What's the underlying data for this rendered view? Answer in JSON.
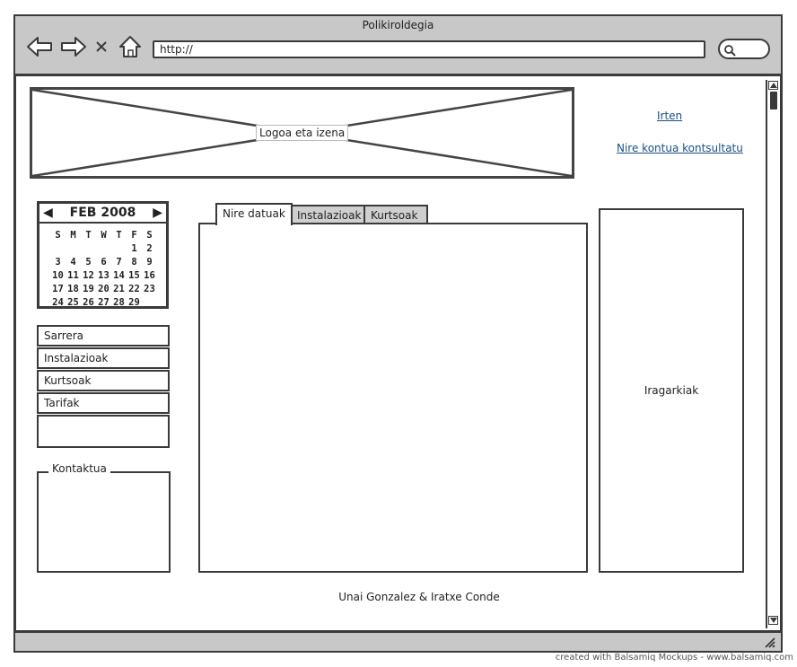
{
  "window": {
    "title": "Polikiroldegia"
  },
  "toolbar": {
    "url": "http://"
  },
  "header": {
    "logo_label": "Logoa eta izena",
    "links": {
      "logout": "Irten",
      "account": "Nire kontua kontsultatu"
    }
  },
  "calendar": {
    "month_label": "FEB 2008",
    "weekdays": [
      "S",
      "M",
      "T",
      "W",
      "T",
      "F",
      "S"
    ],
    "weeks": [
      [
        "",
        "",
        "",
        "",
        "",
        "1",
        "2"
      ],
      [
        "3",
        "4",
        "5",
        "6",
        "7",
        "8",
        "9"
      ],
      [
        "10",
        "11",
        "12",
        "13",
        "14",
        "15",
        "16"
      ],
      [
        "17",
        "18",
        "19",
        "20",
        "21",
        "22",
        "23"
      ],
      [
        "24",
        "25",
        "26",
        "27",
        "28",
        "29",
        ""
      ]
    ]
  },
  "sidebar": {
    "items": [
      {
        "label": "Sarrera"
      },
      {
        "label": "Instalazioak"
      },
      {
        "label": "Kurtsoak"
      },
      {
        "label": "Tarifak"
      }
    ],
    "contact_title": "Kontaktua"
  },
  "tabs": [
    {
      "label": "Nire datuak",
      "active": true
    },
    {
      "label": "Instalazioak",
      "active": false
    },
    {
      "label": "Kurtsoak",
      "active": false
    }
  ],
  "ads": {
    "label": "Iragarkiak"
  },
  "footer": {
    "authors": "Unai Gonzalez & Iratxe Conde"
  },
  "credit": "created with Balsamiq Mockups - www.balsamiq.com",
  "colors": {
    "chrome": "#c8c8c8",
    "border": "#3a3a3a",
    "link": "#1a4f8a",
    "inactive_tab": "#cfcfcf"
  }
}
